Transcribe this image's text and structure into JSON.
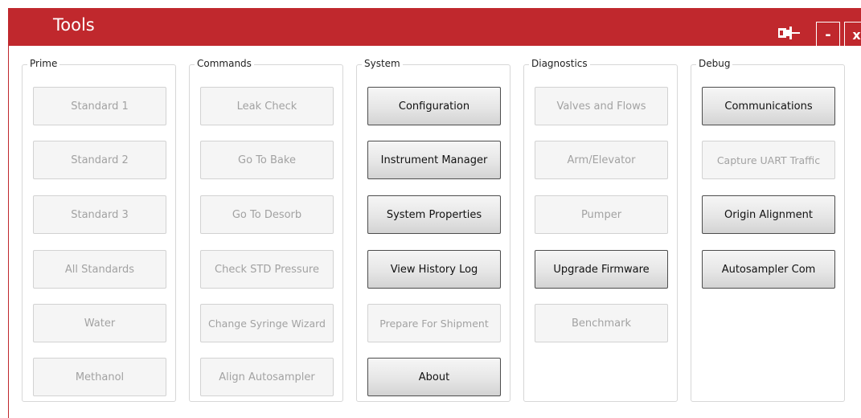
{
  "window": {
    "title": "Tools",
    "minimize_label": "-",
    "close_label": "x"
  },
  "groups": {
    "prime": {
      "title": "Prime",
      "buttons": [
        "Standard 1",
        "Standard 2",
        "Standard 3",
        "All Standards",
        "Water",
        "Methanol"
      ]
    },
    "commands": {
      "title": "Commands",
      "buttons": [
        "Leak Check",
        "Go To Bake",
        "Go To Desorb",
        "Check STD Pressure",
        "Change Syringe Wizard",
        "Align Autosampler"
      ]
    },
    "system": {
      "title": "System",
      "buttons": [
        "Configuration",
        "Instrument Manager",
        "System Properties",
        "View History Log",
        "Prepare For Shipment",
        "About"
      ]
    },
    "diagnostics": {
      "title": "Diagnostics",
      "buttons": [
        "Valves and Flows",
        "Arm/Elevator",
        "Pumper",
        "Upgrade Firmware",
        "Benchmark"
      ]
    },
    "debug": {
      "title": "Debug",
      "buttons": [
        "Communications",
        "Capture UART Traffic",
        "Origin Alignment",
        "Autosampler Com"
      ]
    }
  },
  "colors": {
    "titlebar": "#c0282d",
    "enabled_border": "#4d4d4d",
    "disabled_text": "#a2a2a2"
  },
  "icons": {
    "pin": "pin-icon"
  }
}
